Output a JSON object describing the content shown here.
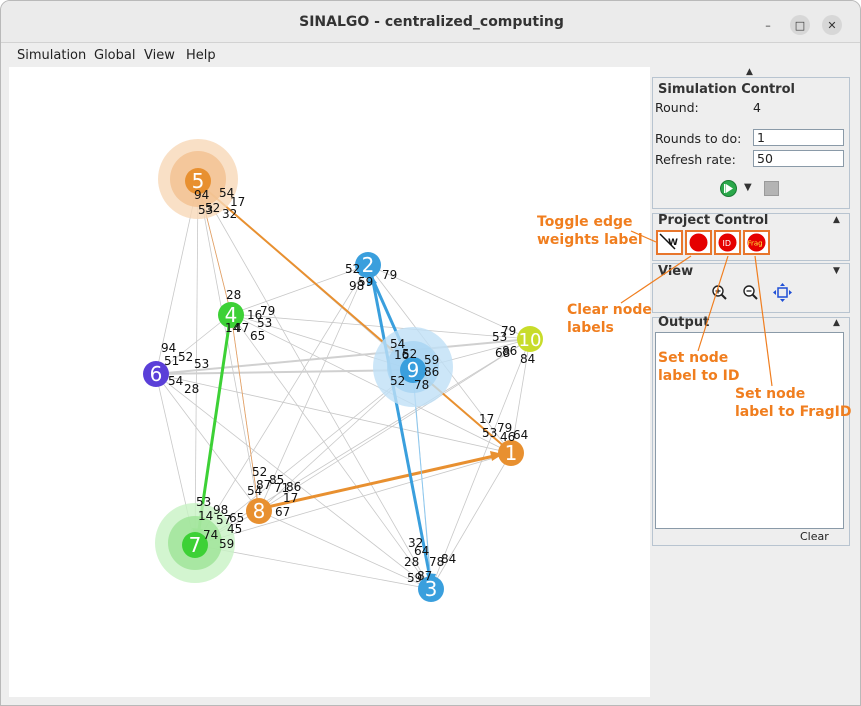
{
  "window": {
    "title": "SINALGO - centralized_computing",
    "controls": {
      "minimize": "–",
      "maximize": "□",
      "close": "✕"
    }
  },
  "menu": [
    "Simulation",
    "Global",
    "View",
    "Help"
  ],
  "simulation_control": {
    "title": "Simulation Control",
    "round_label": "Round:",
    "round_value": "4",
    "rounds_to_do_label": "Rounds to do:",
    "rounds_to_do_value": "1",
    "refresh_rate_label": "Refresh rate:",
    "refresh_rate_value": "50"
  },
  "project_control": {
    "title": "Project Control",
    "buttons": [
      {
        "name": "toggle-edge-weights-button",
        "icon": "w-weight-icon",
        "text": "W"
      },
      {
        "name": "clear-node-labels-button",
        "icon": "red-circle-icon",
        "text": ""
      },
      {
        "name": "node-label-id-button",
        "icon": "red-id-icon",
        "text": "ID"
      },
      {
        "name": "node-label-fragid-button",
        "icon": "red-frag-icon",
        "text": "Frag"
      }
    ]
  },
  "view": {
    "title": "View",
    "icons": [
      "zoom-in-icon",
      "zoom-out-icon",
      "zoom-fit-icon"
    ]
  },
  "output": {
    "title": "Output",
    "clear_label": "Clear"
  },
  "annotations": {
    "toggle_edge_line1": "Toggle edge",
    "toggle_edge_line2": "weights label",
    "clear_labels_line1": "Clear node",
    "clear_labels_line2": "labels",
    "set_id_line1": "Set node",
    "set_id_line2": "label to ID",
    "set_frag_line1": "Set node",
    "set_frag_line2": "label to FragID",
    "color": "#f07e1f"
  },
  "graph": {
    "nodes": [
      {
        "id": "1",
        "color": "#e89030",
        "label_color": "#ffffff"
      },
      {
        "id": "2",
        "color": "#3a9fdd",
        "label_color": "#ffffff"
      },
      {
        "id": "3",
        "color": "#3a9fdd",
        "label_color": "#ffffff"
      },
      {
        "id": "4",
        "color": "#3dd136",
        "label_color": "#ffffff"
      },
      {
        "id": "5",
        "color": "#e89030",
        "label_color": "#ffffff"
      },
      {
        "id": "6",
        "color": "#5a3fd8",
        "label_color": "#ffffff"
      },
      {
        "id": "7",
        "color": "#3dd136",
        "label_color": "#ffffff"
      },
      {
        "id": "8",
        "color": "#e89030",
        "label_color": "#ffffff"
      },
      {
        "id": "9",
        "color": "#3a9fdd",
        "label_color": "#ffffff"
      },
      {
        "id": "10",
        "color": "#c8dc2a",
        "label_color": "#ffffff"
      }
    ],
    "edge_weights": [
      {
        "node": "5",
        "values": [
          "94",
          "54",
          "17",
          "53",
          "32",
          "52"
        ]
      },
      {
        "node": "2",
        "values": [
          "52",
          "79",
          "98",
          "59"
        ]
      },
      {
        "node": "4",
        "values": [
          "28",
          "16",
          "79",
          "53",
          "65",
          "14",
          "47"
        ]
      },
      {
        "node": "9",
        "values": [
          "54",
          "16",
          "59",
          "52",
          "86",
          "78",
          "52"
        ]
      },
      {
        "node": "10",
        "values": [
          "53",
          "79",
          "68",
          "86",
          "84"
        ]
      },
      {
        "node": "6",
        "values": [
          "94",
          "51",
          "52",
          "53",
          "54",
          "28"
        ]
      },
      {
        "node": "1",
        "values": [
          "17",
          "53",
          "79",
          "46",
          "64"
        ]
      },
      {
        "node": "8",
        "values": [
          "52",
          "85",
          "54",
          "87",
          "71",
          "86",
          "17",
          "67"
        ]
      },
      {
        "node": "7",
        "values": [
          "53",
          "98",
          "14",
          "57",
          "65",
          "74",
          "45",
          "59"
        ]
      },
      {
        "node": "3",
        "values": [
          "32",
          "28",
          "64",
          "78",
          "84",
          "59",
          "87"
        ]
      }
    ]
  }
}
